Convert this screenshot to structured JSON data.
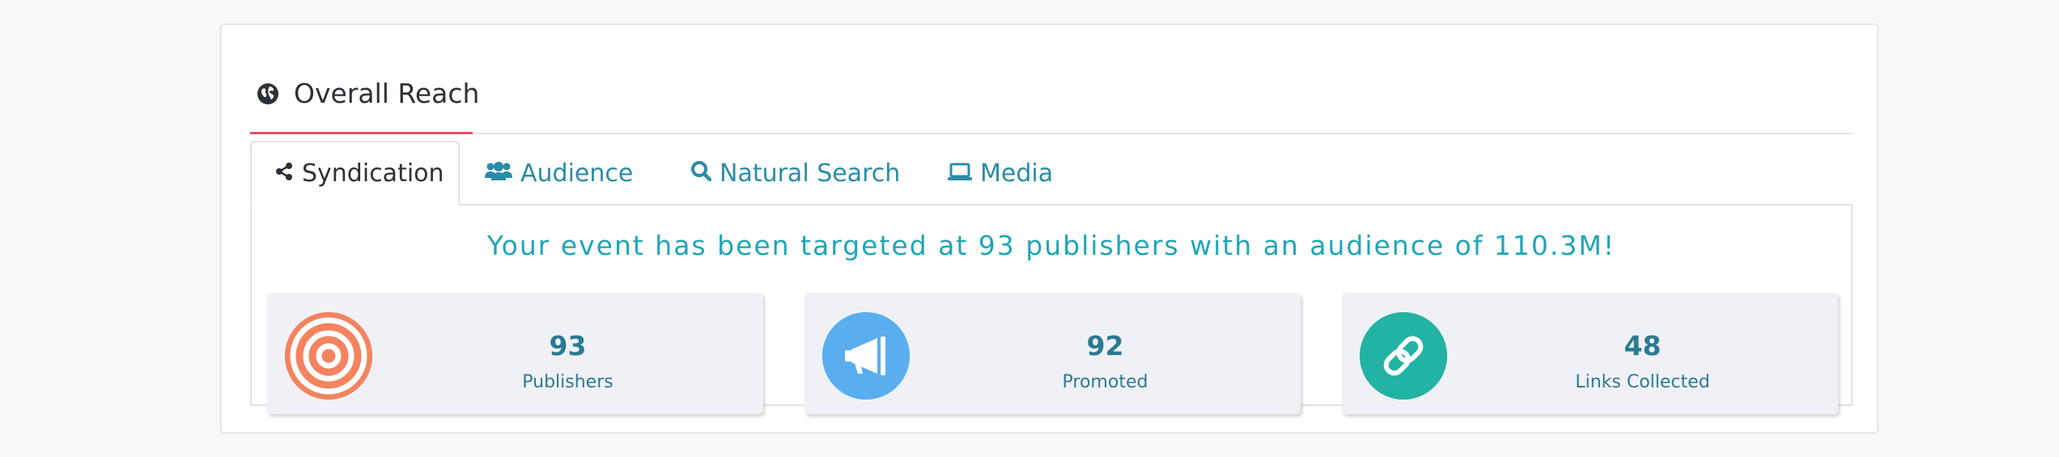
{
  "card": {
    "title": "Overall Reach",
    "icon": "globe-icon"
  },
  "tabs": [
    {
      "label": "Syndication",
      "icon": "share-icon",
      "active": true
    },
    {
      "label": "Audience",
      "icon": "users-icon",
      "active": false
    },
    {
      "label": "Natural Search",
      "icon": "search-icon",
      "active": false
    },
    {
      "label": "Media",
      "icon": "laptop-icon",
      "active": false
    }
  ],
  "panel": {
    "message": "Your event has been targeted at 93 publishers with an audience of 110.3M!"
  },
  "stats": [
    {
      "value": "93",
      "label": "Publishers",
      "icon": "bullseye-icon",
      "color": "#f4845f"
    },
    {
      "value": "92",
      "label": "Promoted",
      "icon": "megaphone-icon",
      "color": "#5aaef0"
    },
    {
      "value": "48",
      "label": "Links Collected",
      "icon": "link-icon",
      "color": "#22b3a4"
    }
  ],
  "colors": {
    "accent": "#e8506a",
    "link": "#2a8ca8",
    "message": "#1ea6b8"
  }
}
